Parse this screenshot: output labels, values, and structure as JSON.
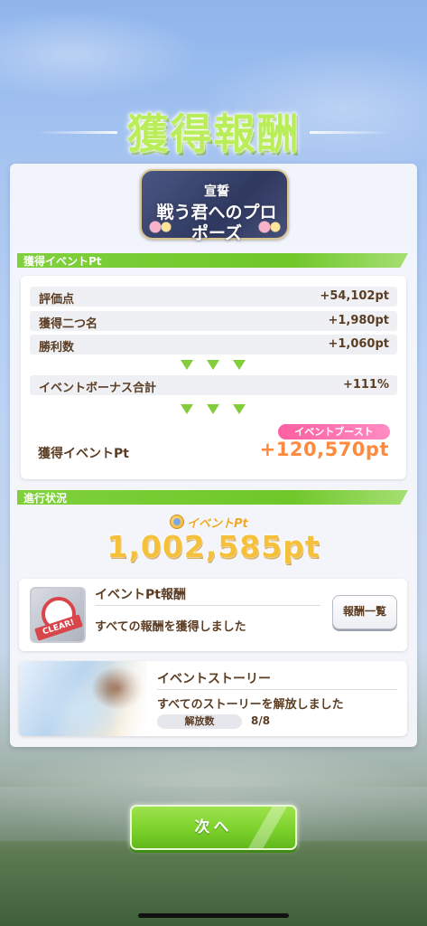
{
  "title": "獲得報酬",
  "event_logo": {
    "line1": "宣誓",
    "line2": "戦う君へのプロポーズ"
  },
  "section_event_pt": {
    "label": "獲得イベントPt",
    "rows": [
      {
        "label": "評価点",
        "value": "+54,102pt"
      },
      {
        "label": "獲得二つ名",
        "value": "+1,980pt"
      },
      {
        "label": "勝利数",
        "value": "+1,060pt"
      }
    ],
    "bonus": {
      "label": "イベントボーナス合計",
      "value": "+111%"
    },
    "boost_badge": "イベントブースト",
    "total": {
      "label": "獲得イベントPt",
      "value": "+120,570pt"
    }
  },
  "section_progress": {
    "label": "進行状況",
    "pt_caption": "イベントPt",
    "pt_total": "1,002,585pt",
    "reward_card": {
      "title": "イベントPt報酬",
      "status": "すべての報酬を獲得しました",
      "badge": "CLEAR!",
      "button": "報酬一覧"
    },
    "story_card": {
      "title": "イベントストーリー",
      "status": "すべてのストーリーを解放しました",
      "unlock_label": "解放数",
      "unlock_count": "8/8"
    }
  },
  "next_button": "次へ",
  "colors": {
    "accent_green": "#7cd12b",
    "text_brown": "#5b3d23",
    "orange": "#ff8a3d",
    "pink": "#ff5fa1",
    "gold": "#f5c03c"
  }
}
